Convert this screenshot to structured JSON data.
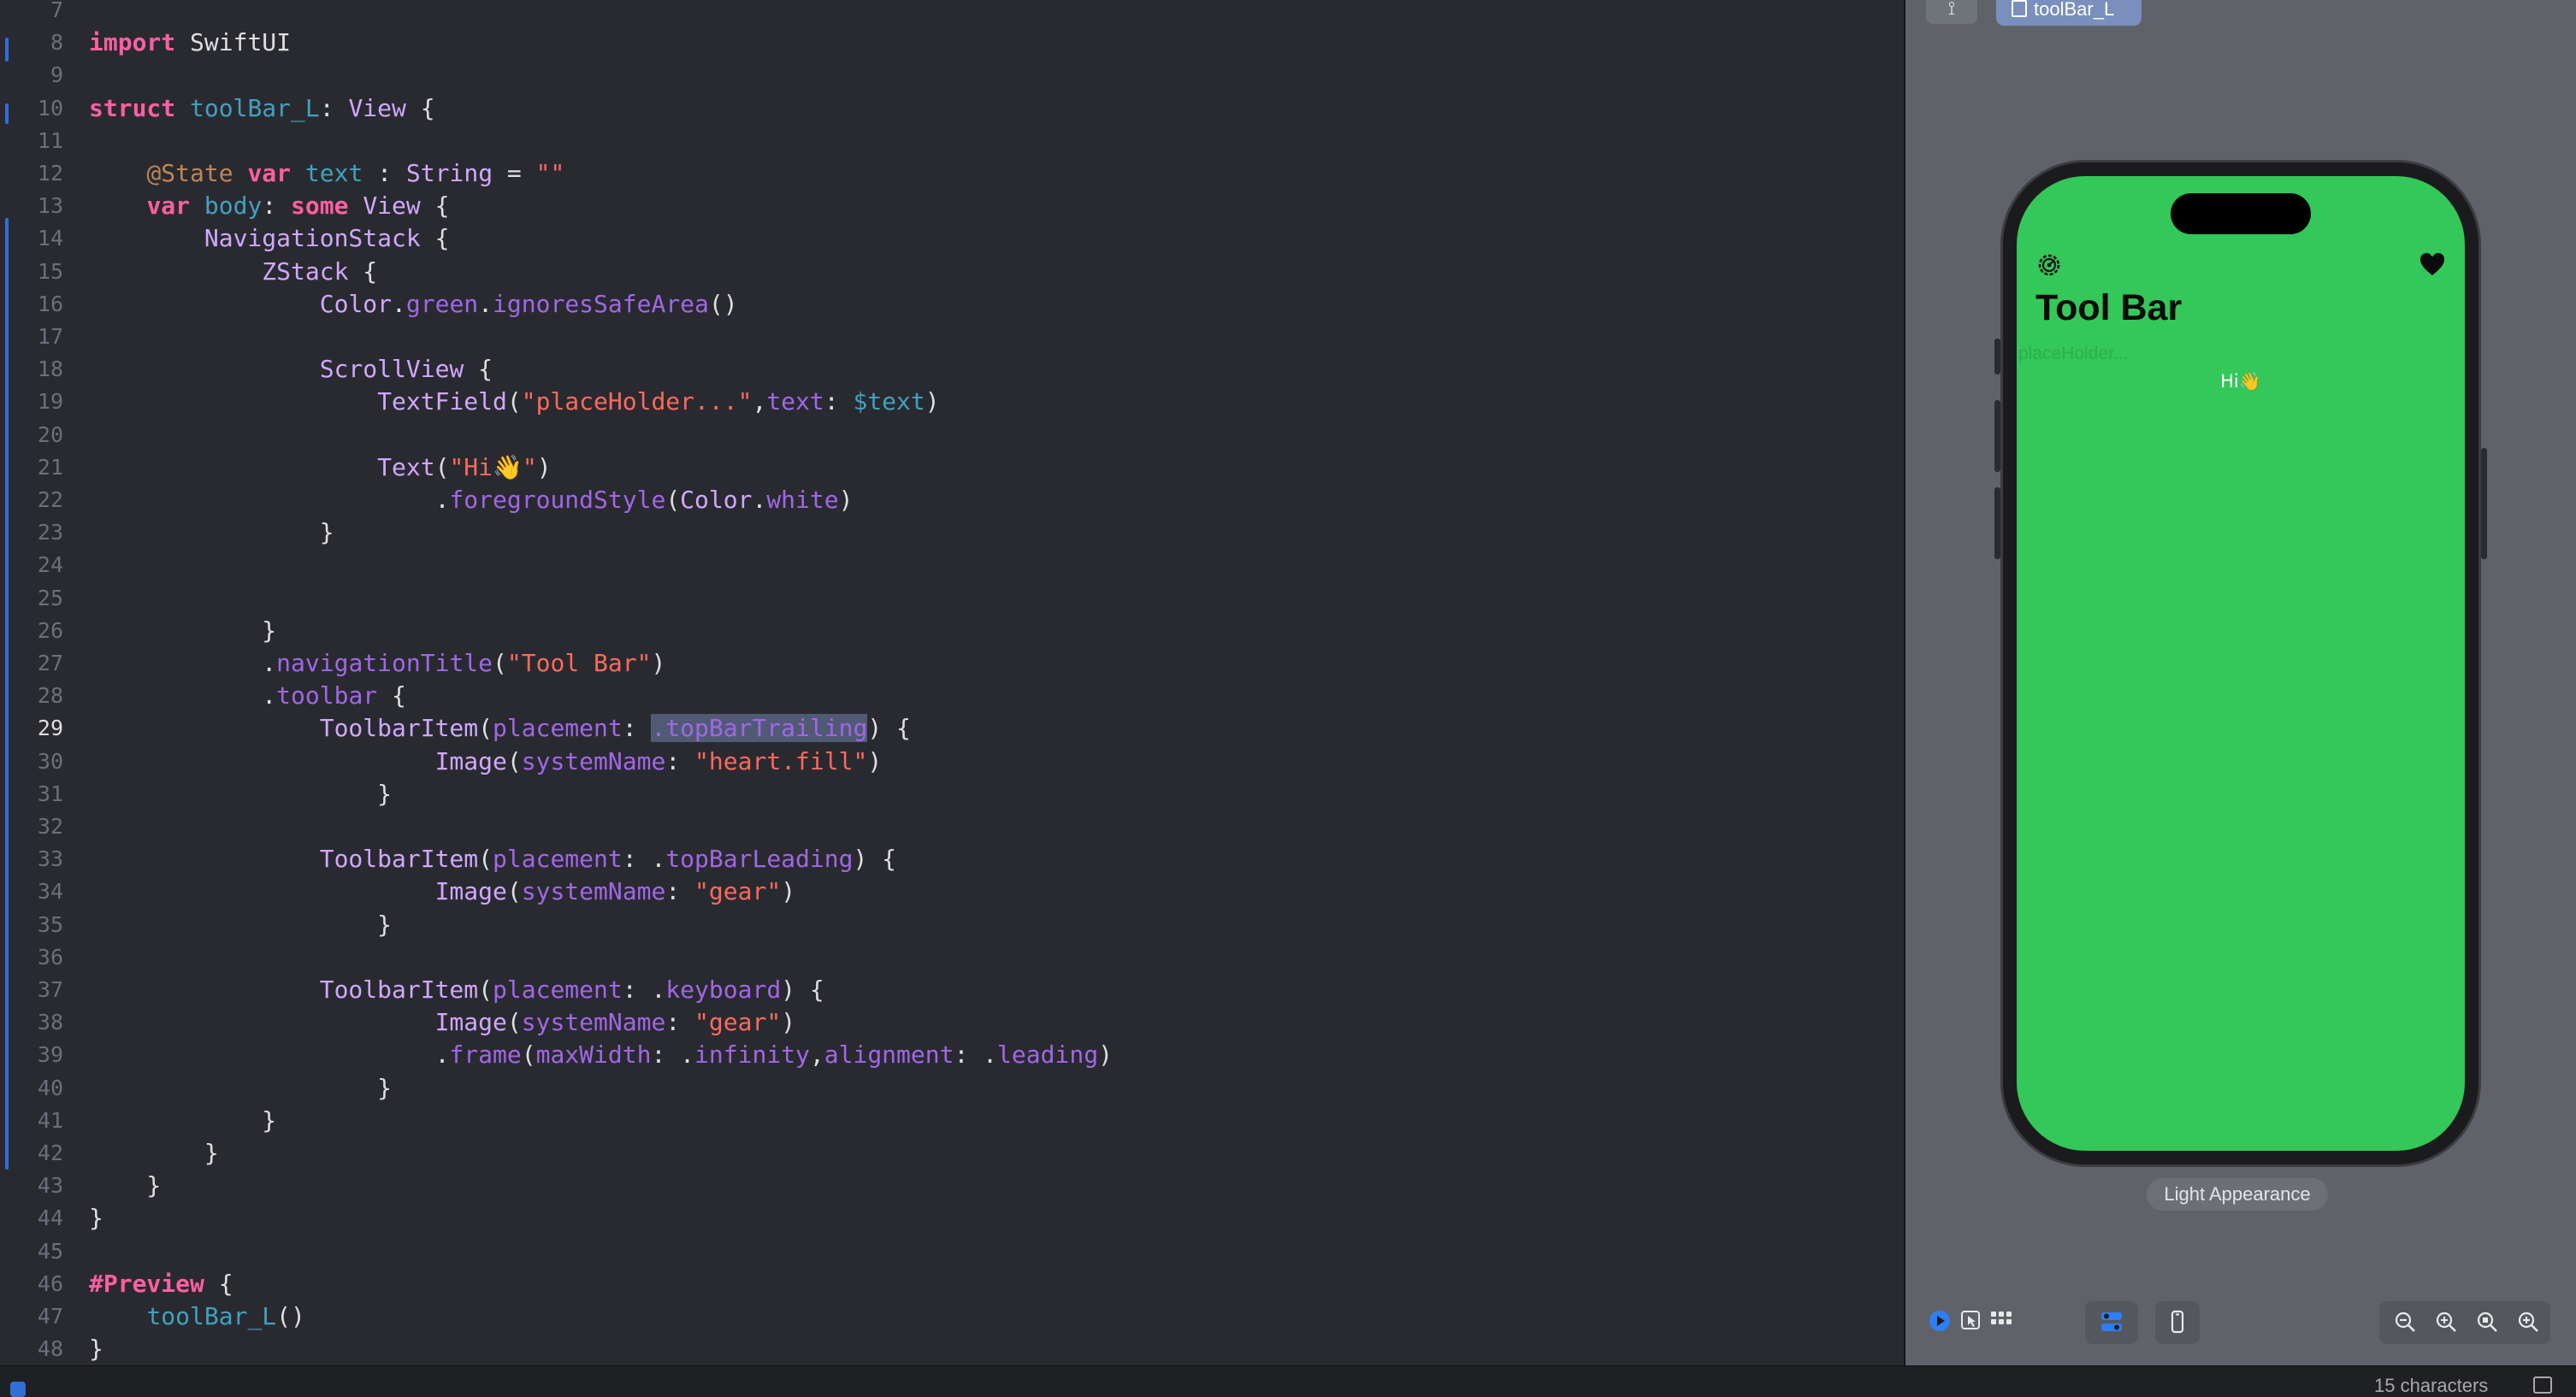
{
  "editor": {
    "current_line": "29",
    "lines": [
      {
        "n": "7",
        "t": []
      },
      {
        "n": "8",
        "t": [
          [
            "kw",
            "import"
          ],
          [
            "pl",
            " SwiftUI"
          ]
        ]
      },
      {
        "n": "9",
        "t": []
      },
      {
        "n": "10",
        "t": [
          [
            "kw",
            "struct"
          ],
          [
            "pl",
            " "
          ],
          [
            "pr",
            "toolBar_L"
          ],
          [
            "pl",
            ": "
          ],
          [
            "ty",
            "View"
          ],
          [
            "pl",
            " {"
          ]
        ]
      },
      {
        "n": "11",
        "t": []
      },
      {
        "n": "12",
        "t": [
          [
            "pl",
            "    "
          ],
          [
            "attr",
            "@State"
          ],
          [
            "pl",
            " "
          ],
          [
            "kw",
            "var"
          ],
          [
            "pl",
            " "
          ],
          [
            "pr",
            "text"
          ],
          [
            "pl",
            " : "
          ],
          [
            "ty",
            "String"
          ],
          [
            "pl",
            " = "
          ],
          [
            "str",
            "\"\""
          ]
        ]
      },
      {
        "n": "13",
        "t": [
          [
            "pl",
            "    "
          ],
          [
            "kw",
            "var"
          ],
          [
            "pl",
            " "
          ],
          [
            "pr",
            "body"
          ],
          [
            "pl",
            ": "
          ],
          [
            "kw",
            "some"
          ],
          [
            "pl",
            " "
          ],
          [
            "ty",
            "View"
          ],
          [
            "pl",
            " {"
          ]
        ]
      },
      {
        "n": "14",
        "t": [
          [
            "pl",
            "        "
          ],
          [
            "ty",
            "NavigationStack"
          ],
          [
            "pl",
            " {"
          ]
        ]
      },
      {
        "n": "15",
        "t": [
          [
            "pl",
            "            "
          ],
          [
            "ty",
            "ZStack"
          ],
          [
            "pl",
            " {"
          ]
        ]
      },
      {
        "n": "16",
        "t": [
          [
            "pl",
            "                "
          ],
          [
            "ty",
            "Color"
          ],
          [
            "pl",
            "."
          ],
          [
            "fn",
            "green"
          ],
          [
            "pl",
            "."
          ],
          [
            "fn",
            "ignoresSafeArea"
          ],
          [
            "pl",
            "()"
          ]
        ]
      },
      {
        "n": "17",
        "t": []
      },
      {
        "n": "18",
        "t": [
          [
            "pl",
            "                "
          ],
          [
            "ty",
            "ScrollView"
          ],
          [
            "pl",
            " {"
          ]
        ]
      },
      {
        "n": "19",
        "t": [
          [
            "pl",
            "                    "
          ],
          [
            "ty",
            "TextField"
          ],
          [
            "pl",
            "("
          ],
          [
            "str",
            "\"placeHolder...\""
          ],
          [
            "pl",
            ","
          ],
          [
            "fn",
            "text"
          ],
          [
            "pl",
            ": "
          ],
          [
            "pr",
            "$text"
          ],
          [
            "pl",
            ")"
          ]
        ]
      },
      {
        "n": "20",
        "t": []
      },
      {
        "n": "21",
        "t": [
          [
            "pl",
            "                    "
          ],
          [
            "ty",
            "Text"
          ],
          [
            "pl",
            "("
          ],
          [
            "str",
            "\"Hi👋\""
          ],
          [
            "pl",
            ")"
          ]
        ]
      },
      {
        "n": "22",
        "t": [
          [
            "pl",
            "                        ."
          ],
          [
            "fn",
            "foregroundStyle"
          ],
          [
            "pl",
            "("
          ],
          [
            "ty",
            "Color"
          ],
          [
            "pl",
            "."
          ],
          [
            "fn",
            "white"
          ],
          [
            "pl",
            ")"
          ]
        ]
      },
      {
        "n": "23",
        "t": [
          [
            "pl",
            "                }"
          ]
        ]
      },
      {
        "n": "24",
        "t": []
      },
      {
        "n": "25",
        "t": []
      },
      {
        "n": "26",
        "t": [
          [
            "pl",
            "            }"
          ]
        ]
      },
      {
        "n": "27",
        "t": [
          [
            "pl",
            "            ."
          ],
          [
            "fn",
            "navigationTitle"
          ],
          [
            "pl",
            "("
          ],
          [
            "str",
            "\"Tool Bar\""
          ],
          [
            "pl",
            ")"
          ]
        ]
      },
      {
        "n": "28",
        "t": [
          [
            "pl",
            "            ."
          ],
          [
            "fn",
            "toolbar"
          ],
          [
            "pl",
            " {"
          ]
        ]
      },
      {
        "n": "29",
        "t": [
          [
            "pl",
            "                "
          ],
          [
            "ty",
            "ToolbarItem"
          ],
          [
            "pl",
            "("
          ],
          [
            "fn",
            "placement"
          ],
          [
            "pl",
            ": "
          ],
          [
            "sel",
            ".topBarTrailing"
          ],
          [
            "pl",
            ") {"
          ]
        ]
      },
      {
        "n": "30",
        "t": [
          [
            "pl",
            "                        "
          ],
          [
            "ty",
            "Image"
          ],
          [
            "pl",
            "("
          ],
          [
            "fn",
            "systemName"
          ],
          [
            "pl",
            ": "
          ],
          [
            "str",
            "\"heart.fill\""
          ],
          [
            "pl",
            ")"
          ]
        ]
      },
      {
        "n": "31",
        "t": [
          [
            "pl",
            "                    }"
          ]
        ]
      },
      {
        "n": "32",
        "t": []
      },
      {
        "n": "33",
        "t": [
          [
            "pl",
            "                "
          ],
          [
            "ty",
            "ToolbarItem"
          ],
          [
            "pl",
            "("
          ],
          [
            "fn",
            "placement"
          ],
          [
            "pl",
            ": ."
          ],
          [
            "fn",
            "topBarLeading"
          ],
          [
            "pl",
            ") {"
          ]
        ]
      },
      {
        "n": "34",
        "t": [
          [
            "pl",
            "                        "
          ],
          [
            "ty",
            "Image"
          ],
          [
            "pl",
            "("
          ],
          [
            "fn",
            "systemName"
          ],
          [
            "pl",
            ": "
          ],
          [
            "str",
            "\"gear\""
          ],
          [
            "pl",
            ")"
          ]
        ]
      },
      {
        "n": "35",
        "t": [
          [
            "pl",
            "                    }"
          ]
        ]
      },
      {
        "n": "36",
        "t": []
      },
      {
        "n": "37",
        "t": [
          [
            "pl",
            "                "
          ],
          [
            "ty",
            "ToolbarItem"
          ],
          [
            "pl",
            "("
          ],
          [
            "fn",
            "placement"
          ],
          [
            "pl",
            ": ."
          ],
          [
            "fn",
            "keyboard"
          ],
          [
            "pl",
            ") {"
          ]
        ]
      },
      {
        "n": "38",
        "t": [
          [
            "pl",
            "                        "
          ],
          [
            "ty",
            "Image"
          ],
          [
            "pl",
            "("
          ],
          [
            "fn",
            "systemName"
          ],
          [
            "pl",
            ": "
          ],
          [
            "str",
            "\"gear\""
          ],
          [
            "pl",
            ")"
          ]
        ]
      },
      {
        "n": "39",
        "t": [
          [
            "pl",
            "                        ."
          ],
          [
            "fn",
            "frame"
          ],
          [
            "pl",
            "("
          ],
          [
            "fn",
            "maxWidth"
          ],
          [
            "pl",
            ": ."
          ],
          [
            "fn",
            "infinity"
          ],
          [
            "pl",
            ","
          ],
          [
            "fn",
            "alignment"
          ],
          [
            "pl",
            ": ."
          ],
          [
            "fn",
            "leading"
          ],
          [
            "pl",
            ")"
          ]
        ]
      },
      {
        "n": "40",
        "t": [
          [
            "pl",
            "                    }"
          ]
        ]
      },
      {
        "n": "41",
        "t": [
          [
            "pl",
            "            }"
          ]
        ]
      },
      {
        "n": "42",
        "t": [
          [
            "pl",
            "        }"
          ]
        ]
      },
      {
        "n": "43",
        "t": [
          [
            "pl",
            "    }"
          ]
        ]
      },
      {
        "n": "44",
        "t": [
          [
            "pl",
            "}"
          ]
        ]
      },
      {
        "n": "45",
        "t": []
      },
      {
        "n": "46",
        "t": [
          [
            "kw",
            "#Preview"
          ],
          [
            "pl",
            " {"
          ]
        ]
      },
      {
        "n": "47",
        "t": [
          [
            "pl",
            "    "
          ],
          [
            "pr",
            "toolBar_L"
          ],
          [
            "pl",
            "()"
          ]
        ]
      },
      {
        "n": "48",
        "t": [
          [
            "pl",
            "}"
          ]
        ]
      }
    ]
  },
  "canvas": {
    "preview_tab_label": "toolBar_L",
    "pin_icon": "pin-icon",
    "phone": {
      "nav_title": "Tool Bar",
      "textfield_placeholder": "placeHolder...",
      "hi_text": "Hi👋",
      "leading_icon": "gear-icon",
      "trailing_icon": "heart-fill-icon"
    },
    "appearance_label": "Light Appearance",
    "controls_left": [
      "live-preview-icon",
      "select-mode-icon",
      "grid-variants-icon"
    ],
    "controls_mid": [
      "canvas-settings-icon"
    ],
    "controls_device": [
      "device-icon"
    ],
    "controls_zoom": [
      "zoom-out-icon",
      "zoom-fit-icon",
      "zoom-actual-icon",
      "zoom-in-icon"
    ]
  },
  "status": {
    "char_count": "15 characters"
  },
  "colors": {
    "editor_bg": "#292a30",
    "keyword": "#fc5fa3",
    "type": "#d0a8ff",
    "function": "#a167e6",
    "property": "#41a1c0",
    "string": "#fc6a5d",
    "preview_green": "#34c759",
    "accent": "#2f6fd7"
  }
}
